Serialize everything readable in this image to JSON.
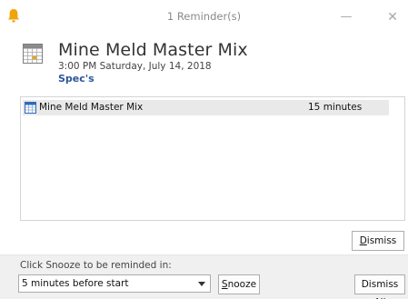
{
  "window": {
    "title": "1 Reminder(s)",
    "minimize_glyph": "—",
    "close_glyph": "✕",
    "bell_icon": "bell-icon",
    "bell_color": "#f0a30a"
  },
  "header": {
    "subject": "Mine Meld Master Mix",
    "when": "3:00 PM Saturday, July 14, 2018",
    "location": "Spec's",
    "location_color": "#2b579a",
    "icon": "calendar-icon"
  },
  "reminders": {
    "items": [
      {
        "subject": "Mine Meld Master Mix",
        "due_in": "15 minutes",
        "selected": true,
        "icon": "calendar-icon"
      }
    ]
  },
  "actions": {
    "dismiss": {
      "pre": "",
      "accel": "D",
      "post": "ismiss"
    },
    "snooze": {
      "pre": "",
      "accel": "S",
      "post": "nooze"
    },
    "dismiss_all": {
      "pre": "Dismiss ",
      "accel": "A",
      "post": "ll"
    }
  },
  "snooze": {
    "label": "Click Snooze to be reminded in:",
    "selected": "5 minutes before start"
  }
}
